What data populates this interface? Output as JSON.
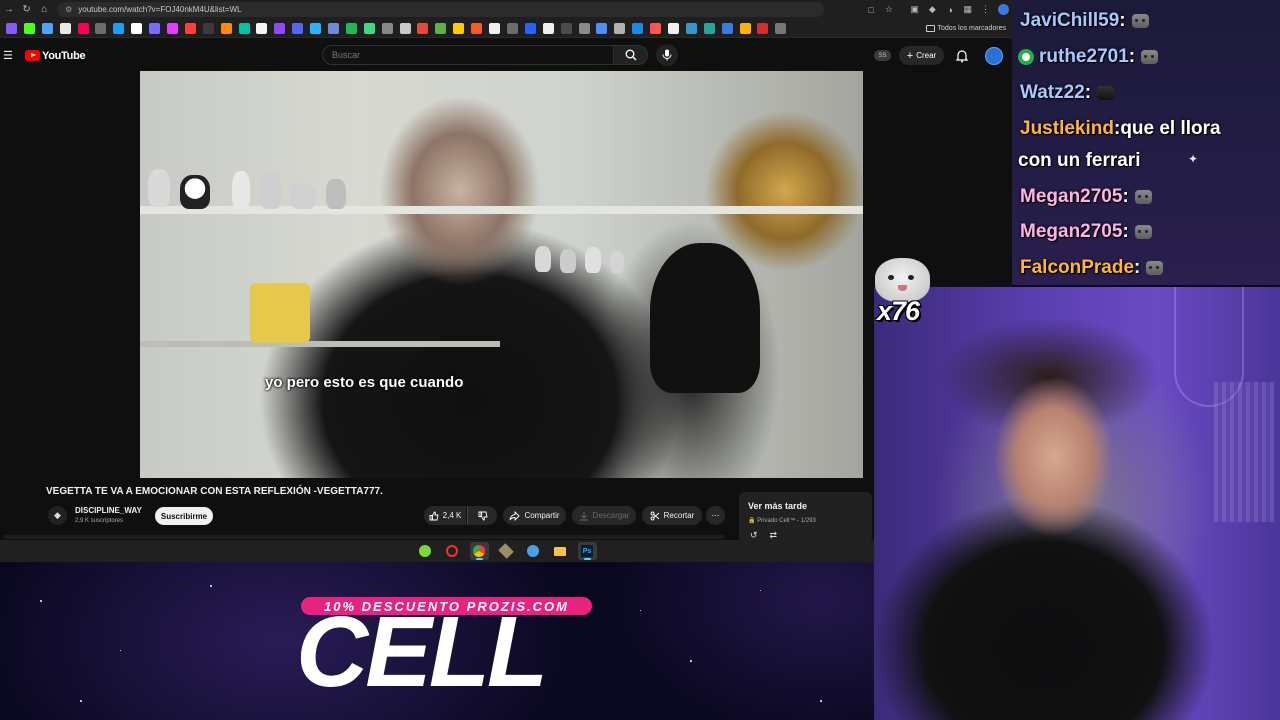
{
  "browser": {
    "url": "youtube.com/watch?v=FOJ40nkM4U&list=WL",
    "bookmarks_all": "Todos los marcadores"
  },
  "youtube": {
    "logo_text": "YouTube",
    "search_placeholder": "Buscar",
    "ss_badge": "SS",
    "create_label": "Crear"
  },
  "video": {
    "subtitle": "yo pero esto es que cuando",
    "title": "VEGETTA TE VA A EMOCIONAR CON ESTA REFLEXIÓN -VEGETTA777.",
    "channel_name": "DISCIPLINE_WAY",
    "channel_subs": "2,9 K suscriptores",
    "subscribe_label": "Suscribirme",
    "likes": "2,4 K",
    "share_label": "Compartir",
    "download_label": "Descargar",
    "clip_label": "Recortar"
  },
  "playlist": {
    "title": "Ver más tarde",
    "meta": "Privado Cell™ - 1/293"
  },
  "chat": {
    "messages": [
      {
        "user": "JaviChill59",
        "sep": " :",
        "text": "",
        "user_color": "#a9c8ff"
      },
      {
        "user": "ruthe2701",
        "sep": " :",
        "text": "",
        "user_color": "#a9c8ff"
      },
      {
        "user": "Watz22",
        "sep": " :",
        "text": "",
        "user_color": "#a9c8ff"
      },
      {
        "user": "Justlekind",
        "sep": " :",
        "text": " que el llora",
        "text2": "con un ferrari",
        "user_color": "#ffb347"
      },
      {
        "user": "Megan2705",
        "sep": " :",
        "text": "",
        "user_color": "#ffb3e0"
      },
      {
        "user": "Megan2705",
        "sep": " :",
        "text": "",
        "user_color": "#ffb3e0"
      },
      {
        "user": "FalconPrade",
        "sep": " :",
        "text": "",
        "user_color": "#ffb347"
      }
    ]
  },
  "emote": {
    "count": "x76"
  },
  "promo": {
    "discount": "10% DESCUENTO PROZIS.COM",
    "brand": "CELL"
  },
  "colors": {
    "youtube_red": "#ff0000",
    "promo_pink": "#e8227e",
    "taskbar_accent": "#60cdff"
  }
}
